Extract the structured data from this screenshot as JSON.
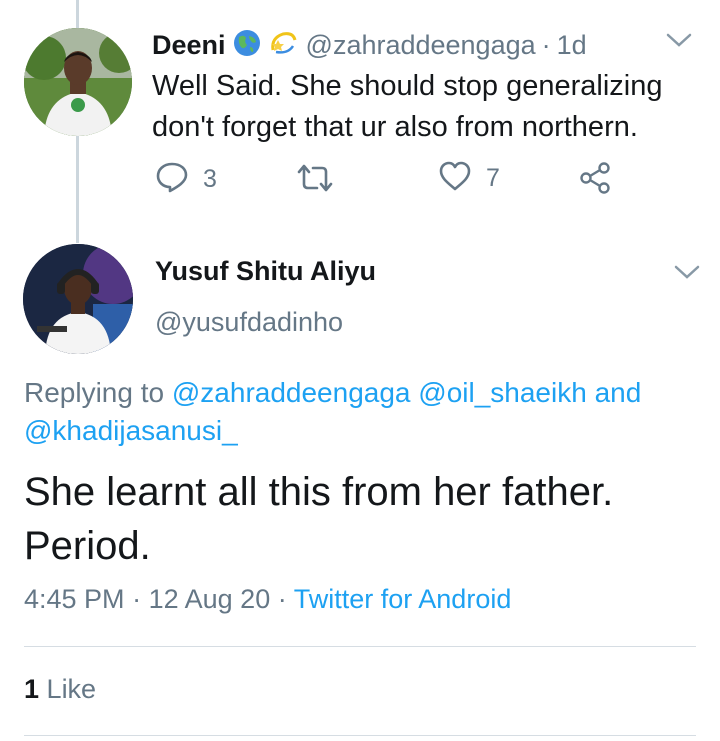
{
  "tweet1": {
    "name": "Deeni",
    "emoji": [
      "globe-emoji",
      "dizzy-emoji"
    ],
    "handle": "@zahraddeengaga",
    "separator": "·",
    "time": "1d",
    "text": "Well Said. She should stop generalizing don't forget that ur also from northern.",
    "reply_count": "3",
    "like_count": "7"
  },
  "tweet2": {
    "name": "Yusuf Shitu Aliyu",
    "handle": "@yusufdadinho",
    "replying_prefix": "Replying to",
    "replying_handles": [
      "@zahraddeengaga",
      "@oil_shaeikh"
    ],
    "replying_and": "and",
    "replying_last": "@khadijasanusi_",
    "text": "She learnt all this from her father. Period.",
    "time": "4:45 PM",
    "date": "12 Aug 20",
    "separator": "·",
    "source": "Twitter for Android",
    "likes_count": "1",
    "likes_label": "Like"
  },
  "colors": {
    "link": "#1da1f2",
    "muted": "#657786",
    "text": "#14171a",
    "divider": "#d6dde3"
  },
  "icons": [
    "reply-icon",
    "retweet-icon",
    "like-icon",
    "share-icon",
    "chevron-down-icon"
  ]
}
